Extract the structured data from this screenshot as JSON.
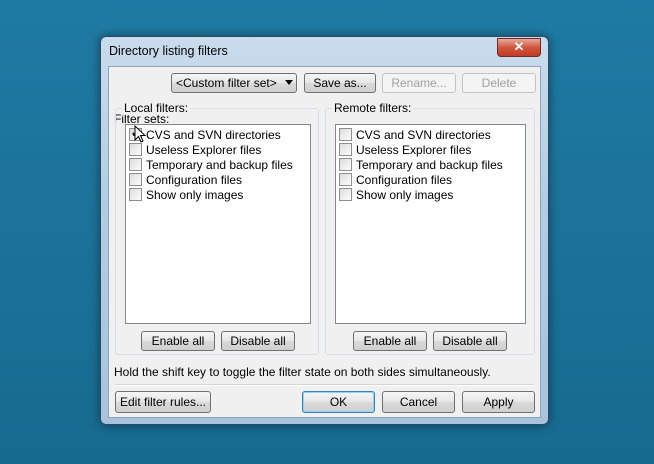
{
  "window": {
    "title": "Directory listing filters",
    "close_glyph": "✕"
  },
  "filter_sets": {
    "label": "Filter sets:",
    "selected": "<Custom filter set>",
    "save_as": "Save as...",
    "rename": "Rename...",
    "delete": "Delete"
  },
  "local": {
    "title": "Local filters:",
    "items": [
      {
        "label": "CVS and SVN directories",
        "checked": true
      },
      {
        "label": "Useless Explorer files",
        "checked": false
      },
      {
        "label": "Temporary and backup files",
        "checked": false
      },
      {
        "label": "Configuration files",
        "checked": false
      },
      {
        "label": "Show only images",
        "checked": false
      }
    ],
    "enable_all": "Enable all",
    "disable_all": "Disable all"
  },
  "remote": {
    "title": "Remote filters:",
    "items": [
      {
        "label": "CVS and SVN directories",
        "checked": false
      },
      {
        "label": "Useless Explorer files",
        "checked": false
      },
      {
        "label": "Temporary and backup files",
        "checked": false
      },
      {
        "label": "Configuration files",
        "checked": false
      },
      {
        "label": "Show only images",
        "checked": false
      }
    ],
    "enable_all": "Enable all",
    "disable_all": "Disable all"
  },
  "hint": "Hold the shift key to toggle the filter state on both sides simultaneously.",
  "footer": {
    "edit_rules": "Edit filter rules...",
    "ok": "OK",
    "cancel": "Cancel",
    "apply": "Apply"
  },
  "check_glyph": "✔"
}
